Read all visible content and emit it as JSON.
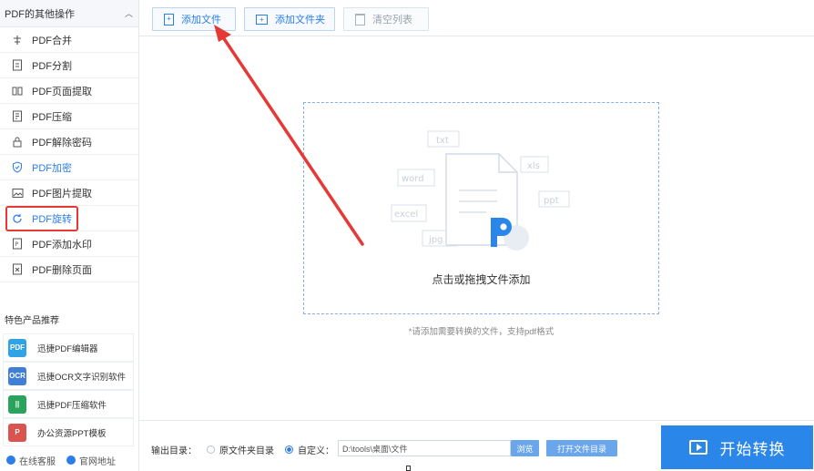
{
  "sidebar": {
    "header_title": "PDF的其他操作",
    "items": [
      {
        "label": "PDF合并",
        "icon": "merge-icon"
      },
      {
        "label": "PDF分割",
        "icon": "split-icon"
      },
      {
        "label": "PDF页面提取",
        "icon": "extract-pages-icon"
      },
      {
        "label": "PDF压缩",
        "icon": "compress-icon"
      },
      {
        "label": "PDF解除密码",
        "icon": "unlock-icon"
      },
      {
        "label": "PDF加密",
        "icon": "shield-icon"
      },
      {
        "label": "PDF图片提取",
        "icon": "image-icon"
      },
      {
        "label": "PDF旋转",
        "icon": "rotate-icon"
      },
      {
        "label": "PDF添加水印",
        "icon": "watermark-icon"
      },
      {
        "label": "PDF删除页面",
        "icon": "delete-page-icon"
      }
    ],
    "active_index": 5,
    "recommend_title": "特色产品推荐",
    "recommend": [
      {
        "label": "迅捷PDF编辑器",
        "color": "#2fa3e6",
        "icon_text": "PDF"
      },
      {
        "label": "迅捷OCR文字识别软件",
        "color": "#3f7fd8",
        "icon_text": "OCR"
      },
      {
        "label": "迅捷PDF压缩软件",
        "color": "#2aa45c",
        "icon_text": "||"
      },
      {
        "label": "办公资源PPT模板",
        "color": "#d9534f",
        "icon_text": "P"
      }
    ],
    "footer": {
      "service": "在线客服",
      "website": "官网地址"
    }
  },
  "toolbar": {
    "add_file": "添加文件",
    "add_folder": "添加文件夹",
    "clear_list": "清空列表"
  },
  "dropzone": {
    "label": "点击或拖拽文件添加",
    "hint": "*请添加需要转换的文件，支持pdf格式",
    "file_tags": [
      "txt",
      "word",
      "xls",
      "ppt",
      "excel",
      "jpg"
    ]
  },
  "bottom": {
    "output_label": "输出目录：",
    "option_source": "原文件夹目录",
    "option_custom": "自定义：",
    "path_value": "D:\\tools\\桌面\\文件",
    "browse": "浏览",
    "open_folder": "打开文件目录",
    "start": "开始转换"
  },
  "colors": {
    "accent": "#2b86ea",
    "highlight": "#e53935"
  }
}
